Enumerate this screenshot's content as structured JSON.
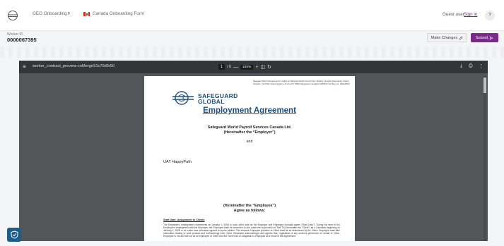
{
  "header": {
    "breadcrumb": [
      "GEO Onboarding",
      "Canada Onboarding Form"
    ],
    "chevron": "›",
    "guest_label": "Guest user.",
    "signin_label": "Sign in",
    "help_label": "?"
  },
  "worker": {
    "label": "Worker ID",
    "id": "0000067395"
  },
  "actions": {
    "make_changes": "Make Changes",
    "make_changes_icon": "edit-icon",
    "submit": "Submit",
    "submit_icon": "send-icon",
    "accent": "#7b2a8b"
  },
  "viewer": {
    "filename": "worker_contract_preview-cnMergeS1c70d5r50",
    "page_current": "1",
    "page_sep": "/ 6",
    "zoom": "100%",
    "zoom_minus": "—",
    "zoom_plus": "+"
  },
  "document": {
    "company_line1": "SAFEGUARD",
    "company_line2": "GLOBAL",
    "address": "Safeguard World International Ltd. trading as Safeguard Global Ground Floor, Building 2 Caspian Park Harsby Chapel Cheshire, CW4 8XE United Kingdom +44 (0) 1270 758600 Registered in England 3435526 | VAT Reg. No. GB2428504",
    "title": "Employment Agreement",
    "employer_line1": "Safeguard World Payroll Services Canada Ltd.",
    "employer_line2": "(Hereinafter the “Employer”)",
    "and": "and",
    "employee_name": "UAT HappyPath",
    "employee_line1": "(Hereinafter the “Employee”)",
    "employee_line2": "Agree as follows:",
    "section_title": "Start Date; Assignment to Clients",
    "paragraph": "The Employee's employment commences on January 1, 2008 or such other date as the Employer and Employee mutually agree (\"Start Date\"). During the term of the Employee's employment with the Employer, the Employee shall be seconded to and under the supervision of Test TN (hereinafter the \"Client\") as a Canadian beginning on January 1, 2008 or at a later time otherwise agreed to by the parties. The services Employee provides to Client shall be as determined by the Client. Employee shall take instruction relating to work product and methodology from Client. Employee acknowledges and agrees that, regardless of any services performed on behalf of Client, Employee is not and will not be an employee of Client and the Client has no obligation to employee as a result of this Agreement."
  }
}
